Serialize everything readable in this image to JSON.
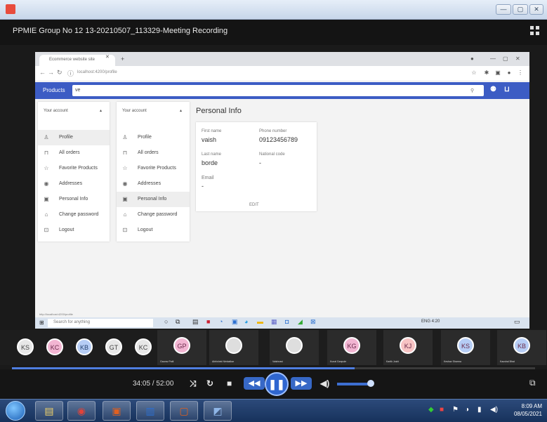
{
  "window": {
    "title": "PPMIE Group No 12  13-20210507_113329-Meeting Recording"
  },
  "browser": {
    "tab_title": "Ecommerce website site",
    "address": "localhost:4200/profile"
  },
  "app_bar": {
    "brand_label": "Products",
    "search_value": "ve"
  },
  "panels": {
    "left": {
      "header": "Your account",
      "items": [
        {
          "label": "Profile",
          "icon": "person-icon"
        },
        {
          "label": "All orders",
          "icon": "cart-icon"
        },
        {
          "label": "Favorite Products",
          "icon": "star-icon"
        },
        {
          "label": "Addresses",
          "icon": "location-icon"
        },
        {
          "label": "Personal Info",
          "icon": "id-card-icon"
        },
        {
          "label": "Change password",
          "icon": "lock-icon"
        },
        {
          "label": "Logout",
          "icon": "logout-icon"
        }
      ]
    },
    "right": {
      "header": "Your account",
      "items": [
        {
          "label": "Profile"
        },
        {
          "label": "All orders"
        },
        {
          "label": "Favorite Products"
        },
        {
          "label": "Addresses"
        },
        {
          "label": "Personal Info"
        },
        {
          "label": "Change password"
        },
        {
          "label": "Logout"
        }
      ]
    }
  },
  "personal_info": {
    "title": "Personal Info",
    "first_name_label": "First name",
    "first_name_value": "vaish",
    "phone_label": "Phone number",
    "phone_value": "09123456789",
    "last_name_label": "Last name",
    "last_name_value": "borde",
    "national_code_label": "National code",
    "national_code_value": "-",
    "email_label": "Email",
    "email_value": "-",
    "edit_label": "EDIT"
  },
  "win_taskbar": {
    "search_placeholder": "Search for anything",
    "tray_text": "ENG 4:20",
    "tooltip": "http://localhost:4200/profile"
  },
  "participants": [
    {
      "initials": "KS",
      "color": "#e7e7e7",
      "text": "#444"
    },
    {
      "initials": "KC",
      "color": "#f2b5d2",
      "text": "#6a2a4a"
    },
    {
      "initials": "KB",
      "color": "#b6cdf5",
      "text": "#23406e"
    },
    {
      "initials": "GT",
      "color": "#e7e7e7",
      "text": "#444"
    },
    {
      "initials": "KC",
      "color": "#e7e7e7",
      "text": "#444"
    }
  ],
  "tiles": [
    {
      "initials": "GP",
      "name": "Gaurav Patil",
      "color": "#f2b5d2"
    },
    {
      "initials": "",
      "name": "Abhishek Nimbalkar",
      "color": "#dedede"
    },
    {
      "initials": "",
      "name": "Vaishnavi",
      "color": "#dedede"
    },
    {
      "initials": "KG",
      "color": "#f2b5d2",
      "name": "Kunal Ganpule"
    },
    {
      "initials": "KJ",
      "color": "#f7c3c3",
      "name": "Kartik Joshi"
    },
    {
      "initials": "KS",
      "color": "#b6cdf5",
      "name": "Keshav Sharma"
    },
    {
      "initials": "KB",
      "color": "#b6cdf5",
      "name": "Kaushal Bhat"
    }
  ],
  "player": {
    "time": "34:05 / 52:00",
    "progress": 0.655,
    "volume": 0.92
  },
  "system_clock": {
    "time": "8:09 AM",
    "date": "08/05/2021"
  }
}
